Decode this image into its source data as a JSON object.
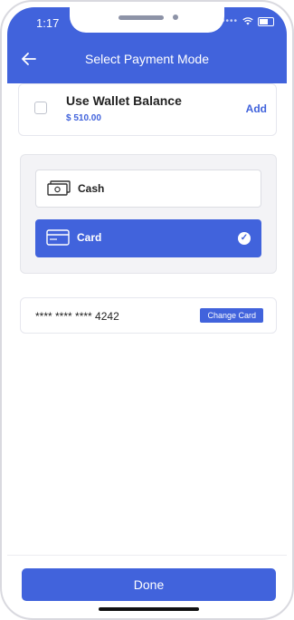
{
  "status_bar": {
    "time": "1:17"
  },
  "header": {
    "title": "Select Payment Mode",
    "back_icon": "arrow-left-icon"
  },
  "wallet": {
    "label": "Use Wallet Balance",
    "amount": "$ 510.00",
    "action": "Add",
    "checked": false
  },
  "payment_modes": [
    {
      "label": "Cash",
      "icon": "cash-icon",
      "selected": false
    },
    {
      "label": "Card",
      "icon": "card-icon",
      "selected": true
    }
  ],
  "saved_card": {
    "number": "**** **** **** 4242",
    "action": "Change Card"
  },
  "footer": {
    "done_label": "Done"
  },
  "colors": {
    "accent": "#4163dc",
    "panel": "#f3f3f6"
  }
}
